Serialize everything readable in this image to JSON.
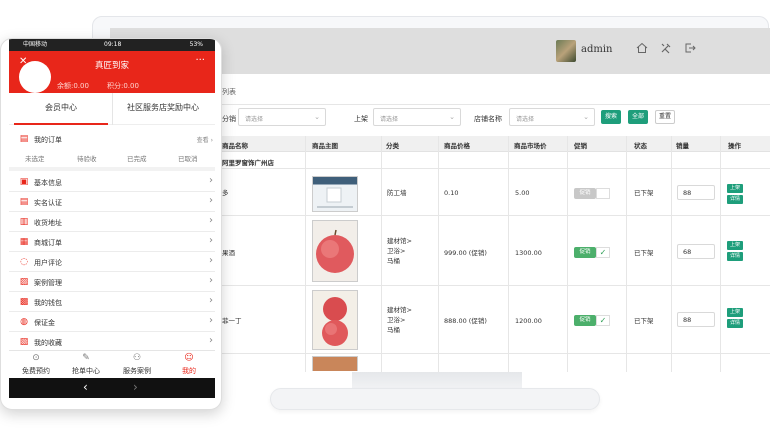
{
  "monitor": {
    "user": {
      "name": "admin"
    },
    "toolbar_icons": [
      "home-icon",
      "tools-icon",
      "logout-icon"
    ],
    "breadcrumb": "列表",
    "filters": {
      "f1": {
        "label": "分销",
        "placeholder": "请选择"
      },
      "f2": {
        "label": "上架",
        "placeholder": "请选择"
      },
      "f3": {
        "label": "店铺名称",
        "placeholder": "请选择"
      },
      "buttons": {
        "search": "搜索",
        "all": "全部",
        "reset": "重置"
      }
    },
    "table": {
      "headers": [
        "商品名称",
        "商品主图",
        "分类",
        "商品价格",
        "商品市场价",
        "促销",
        "状态",
        "销量",
        "操作"
      ],
      "store": "阿里罗窗饰广州店",
      "rows": [
        {
          "name": "多",
          "category": "防工墙",
          "price": "0.10",
          "market_price": "5.00",
          "promo": "促销",
          "status": "已下架",
          "sales": "88",
          "actions": [
            "上架",
            "详情"
          ]
        },
        {
          "name": "果酒",
          "category": "建材馆>\n卫浴>\n马桶",
          "price": "999.00 (促销)",
          "market_price": "1300.00",
          "promo": "促销",
          "status": "已下架",
          "sales": "68",
          "actions": [
            "上架",
            "详情"
          ]
        },
        {
          "name": "菲一丁",
          "category": "建材馆>\n卫浴>\n马桶",
          "price": "888.00 (促销)",
          "market_price": "1200.00",
          "promo": "促销",
          "status": "已下架",
          "sales": "88",
          "actions": [
            "上架",
            "详情"
          ]
        }
      ]
    }
  },
  "phone": {
    "status": {
      "carrier": "中国移动",
      "time": "09:18",
      "battery": "53%"
    },
    "header": {
      "title": "真匠到家",
      "balance1": "余额:0.00",
      "balance2": "积分:0.00"
    },
    "tabs": [
      "会员中心",
      "社区服务店奖励中心"
    ],
    "orders": {
      "title": "我的订单",
      "link": "查看"
    },
    "order_status": [
      "未选定",
      "待验收",
      "已完成",
      "已取消"
    ],
    "menu": [
      "基本信息",
      "实名认证",
      "收货地址",
      "商城订单",
      "用户评论",
      "案例管理",
      "我的钱包",
      "保证金",
      "我的收藏"
    ],
    "bottom_nav": [
      "免费预约",
      "抢单中心",
      "服务案例",
      "我的"
    ],
    "colors": {
      "accent": "#e8261a",
      "green": "#1e9e7b"
    }
  }
}
